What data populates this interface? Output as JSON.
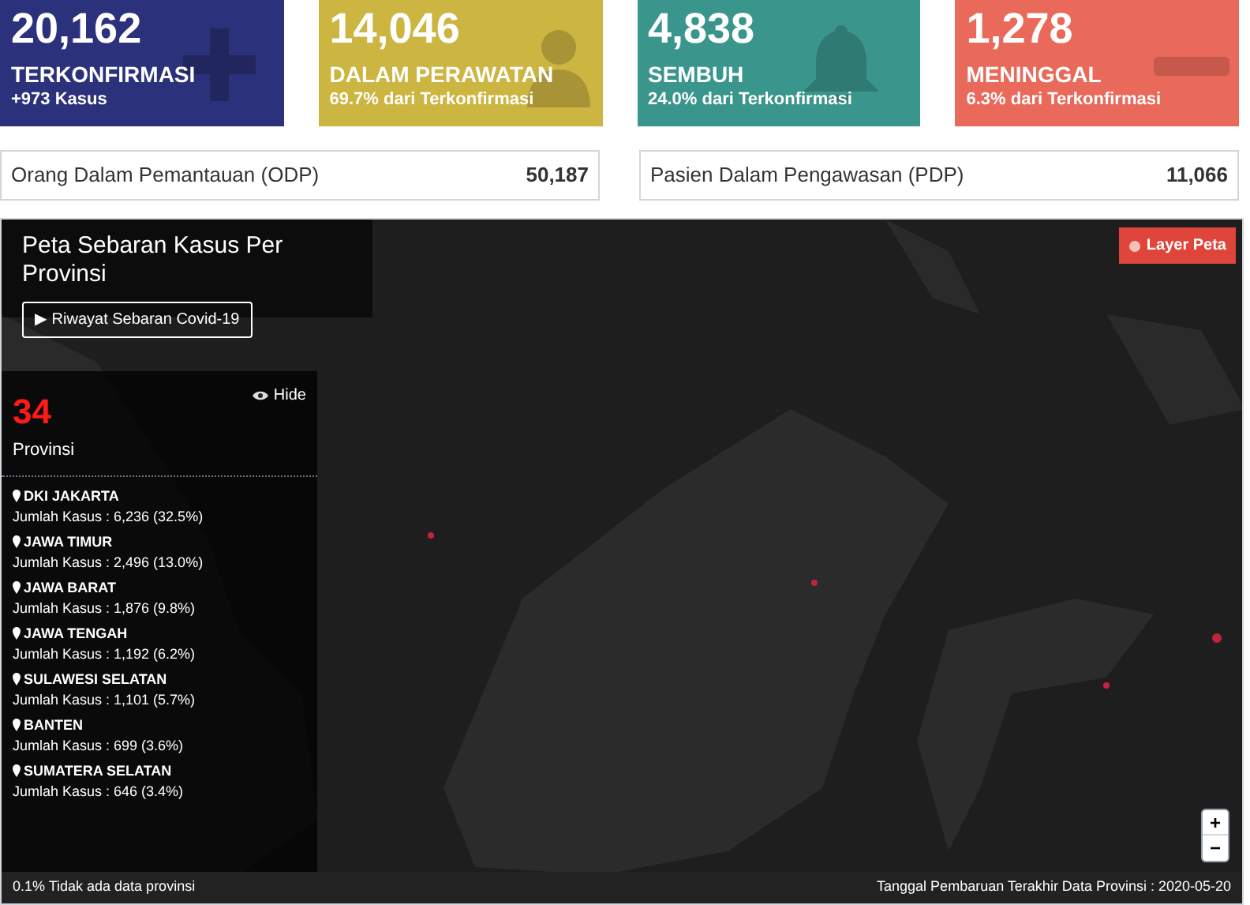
{
  "cards": [
    {
      "kind": "plus",
      "value": "20,162",
      "label": "TERKONFIRMASI",
      "sub": "+973 Kasus",
      "color": "#2b317a"
    },
    {
      "kind": "person",
      "value": "14,046",
      "label": "DALAM PERAWATAN",
      "sub": "69.7% dari Terkonfirmasi",
      "color": "#cdb542"
    },
    {
      "kind": "bell",
      "value": "4,838",
      "label": "SEMBUH",
      "sub": "24.0% dari Terkonfirmasi",
      "color": "#3a958c"
    },
    {
      "kind": "minus",
      "value": "1,278",
      "label": "MENINGGAL",
      "sub": "6.3% dari Terkonfirmasi",
      "color": "#e9695a"
    }
  ],
  "summary": [
    {
      "label": "Orang Dalam Pemantauan (ODP)",
      "value": "50,187"
    },
    {
      "label": "Pasien Dalam Pengawasan (PDP)",
      "value": "11,066"
    }
  ],
  "map": {
    "title": "Peta Sebaran Kasus Per Provinsi",
    "history_button": "▶ Riwayat Sebaran Covid-19",
    "layer_button": "Layer Peta",
    "zoom_in": "+",
    "zoom_out": "−",
    "panel": {
      "hide": "Hide",
      "count": "34",
      "count_label": "Provinsi",
      "provinces": [
        {
          "name": "DKI JAKARTA",
          "cases": "Jumlah Kasus : 6,236 (32.5%)"
        },
        {
          "name": "JAWA TIMUR",
          "cases": "Jumlah Kasus : 2,496 (13.0%)"
        },
        {
          "name": "JAWA BARAT",
          "cases": "Jumlah Kasus : 1,876 (9.8%)"
        },
        {
          "name": "JAWA TENGAH",
          "cases": "Jumlah Kasus : 1,192 (6.2%)"
        },
        {
          "name": "SULAWESI SELATAN",
          "cases": "Jumlah Kasus : 1,101 (5.7%)"
        },
        {
          "name": "BANTEN",
          "cases": "Jumlah Kasus : 699 (3.6%)"
        },
        {
          "name": "SUMATERA SELATAN",
          "cases": "Jumlah Kasus : 646 (3.4%)"
        }
      ]
    },
    "footer_left": "0.1% Tidak ada data provinsi",
    "footer_right": "Tanggal Pembaruan Terakhir Data Provinsi : 2020-05-20"
  }
}
